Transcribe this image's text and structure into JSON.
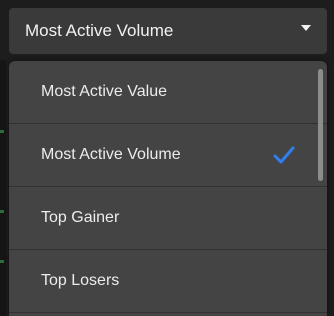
{
  "dropdown": {
    "selected_value": "Most Active Volume",
    "caret_icon": "caret-down-icon",
    "options": [
      {
        "label": "Most Active Value",
        "selected": false
      },
      {
        "label": "Most Active Volume",
        "selected": true
      },
      {
        "label": "Top Gainer",
        "selected": false
      },
      {
        "label": "Top Losers",
        "selected": false
      }
    ],
    "check_icon": "checkmark-icon",
    "check_color": "#2f7ff0"
  },
  "colors": {
    "background": "#1d1d1d",
    "select_bg": "#3a3a3a",
    "menu_bg": "#444444",
    "text": "#ececec"
  }
}
